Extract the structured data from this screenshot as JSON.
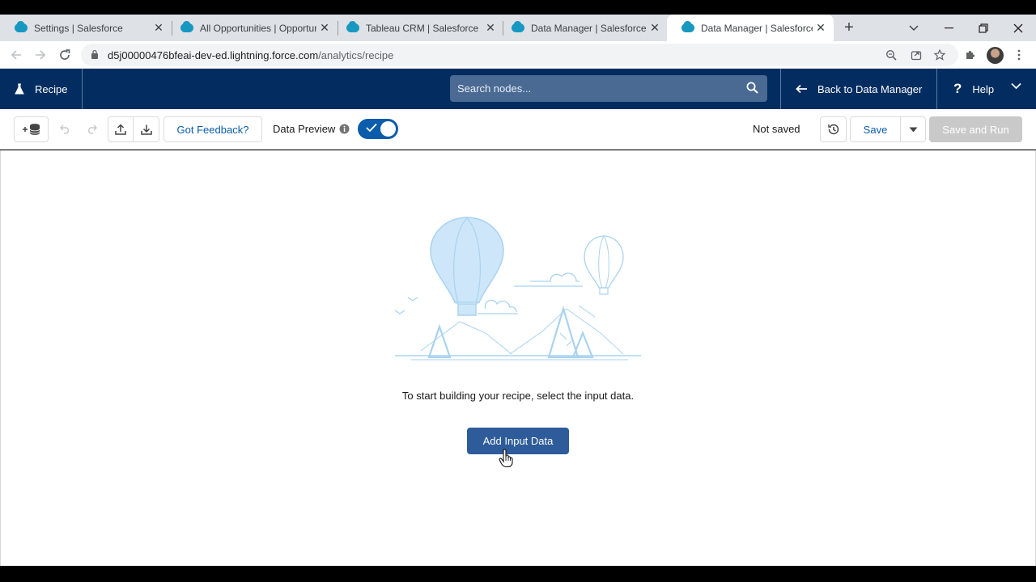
{
  "browser": {
    "tabs": [
      {
        "label": "Settings | Salesforce"
      },
      {
        "label": "All Opportunities | Opportuni"
      },
      {
        "label": "Tableau CRM | Salesforce"
      },
      {
        "label": "Data Manager | Salesforce"
      },
      {
        "label": "Data Manager | Salesforce",
        "active": true
      }
    ],
    "close_glyph": "✕",
    "new_tab_glyph": "+",
    "url_host": "d5j00000476bfeai-dev-ed.lightning.force.com",
    "url_path": "/analytics/recipe"
  },
  "header": {
    "app_name": "Recipe",
    "search_placeholder": "Search nodes...",
    "back_label": "Back to Data Manager",
    "help_label": "Help"
  },
  "toolbar": {
    "feedback_label": "Got Feedback?",
    "data_preview_label": "Data Preview",
    "data_preview_on": true,
    "status_text": "Not saved",
    "save_label": "Save",
    "save_and_run_label": "Save and Run"
  },
  "canvas": {
    "empty_message": "To start building your recipe, select the input data.",
    "add_input_label": "Add Input Data"
  },
  "colors": {
    "header_bg": "#032d60",
    "brand_blue": "#0b5cab",
    "primary_button": "#2e5b9a",
    "illustration": "#a9d3f0"
  }
}
